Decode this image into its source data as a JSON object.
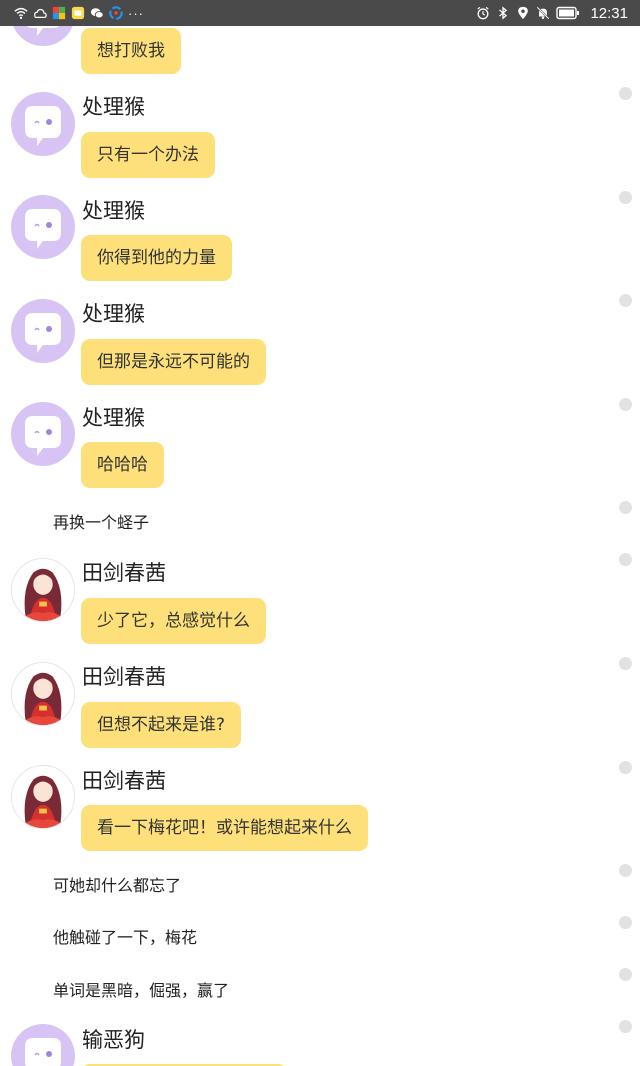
{
  "status_bar": {
    "time": "12:31",
    "overflow_dots": "···",
    "left_icons": [
      "wifi-icon",
      "cloud-icon",
      "app-color-icon",
      "app-yellow-icon",
      "wechat-icon",
      "browser-icon"
    ],
    "right_icons": [
      "alarm-icon",
      "bluetooth-icon",
      "location-icon",
      "mute-bell-icon",
      "battery-icon"
    ]
  },
  "colors": {
    "status_bar_bg": "#4a4a4a",
    "bubble": "#fde07a",
    "avatar_purple": "#d7c4f5",
    "read_dot": "#e2e2e2"
  },
  "messages": [
    {
      "type": "bubble_continuation",
      "avatar": "purple-chat-avatar",
      "text": "想打败我"
    },
    {
      "type": "message",
      "sender": "处理猴",
      "avatar": "purple-chat-avatar",
      "text": "只有一个办法"
    },
    {
      "type": "message",
      "sender": "处理猴",
      "avatar": "purple-chat-avatar",
      "text": "你得到他的力量"
    },
    {
      "type": "message",
      "sender": "处理猴",
      "avatar": "purple-chat-avatar",
      "text": "但那是永远不可能的"
    },
    {
      "type": "message",
      "sender": "处理猴",
      "avatar": "purple-chat-avatar",
      "text": "哈哈哈"
    },
    {
      "type": "narration",
      "text": "再换一个蛏子"
    },
    {
      "type": "message",
      "sender": "田剑春茜",
      "avatar": "anime-girl-avatar",
      "text": "少了它，总感觉什么"
    },
    {
      "type": "message",
      "sender": "田剑春茜",
      "avatar": "anime-girl-avatar",
      "text": "但想不起来是谁?"
    },
    {
      "type": "message",
      "sender": "田剑春茜",
      "avatar": "anime-girl-avatar",
      "text": "看一下梅花吧！或许能想起来什么"
    },
    {
      "type": "narration",
      "text": "可她却什么都忘了"
    },
    {
      "type": "narration",
      "text": "他触碰了一下，梅花"
    },
    {
      "type": "narration",
      "text": "单词是黑暗，倔强，赢了"
    },
    {
      "type": "message_partial",
      "sender": "输恶狗",
      "avatar": "purple-chat-avatar"
    }
  ]
}
